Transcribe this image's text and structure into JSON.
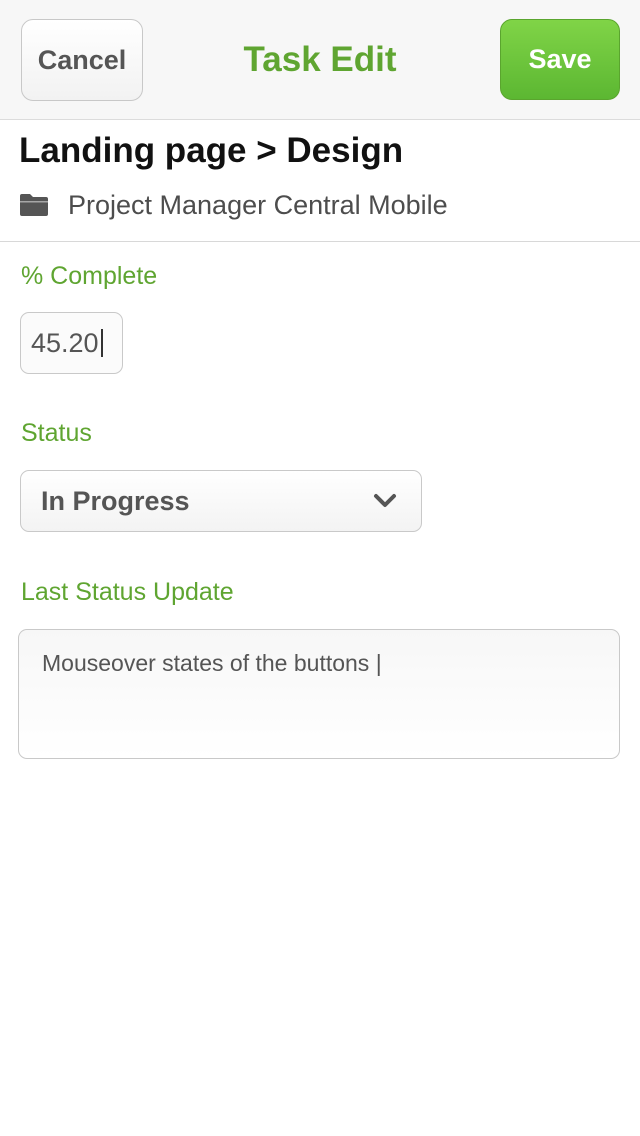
{
  "header": {
    "cancel_label": "Cancel",
    "title": "Task Edit",
    "save_label": "Save"
  },
  "task": {
    "title": "Landing page > Design",
    "project_icon": "folder-icon",
    "project_name": "Project Manager Central Mobile"
  },
  "form": {
    "percent_complete": {
      "label": "% Complete",
      "value": "45.20"
    },
    "status": {
      "label": "Status",
      "selected": "In Progress",
      "icon": "chevron-down-icon"
    },
    "last_status_update": {
      "label": "Last Status Update",
      "value": "Mouseover states of the buttons |"
    }
  },
  "colors": {
    "accent_green": "#5fa531",
    "save_button": "#6cc23b",
    "text_gray": "#555555"
  }
}
